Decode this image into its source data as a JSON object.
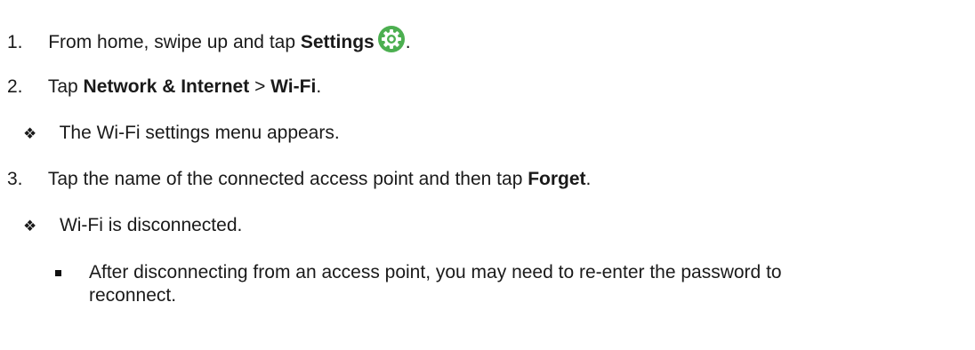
{
  "steps": [
    {
      "number": "1.",
      "pre": "From home, swipe up and tap ",
      "bold": "Settings",
      "post": "."
    },
    {
      "number": "2.",
      "pre": "Tap ",
      "bold1": "Network & Internet",
      "mid": " > ",
      "bold2": "Wi-Fi",
      "post": "."
    },
    {
      "number": "3.",
      "pre": "Tap the name of the connected access point and then tap ",
      "bold": "Forget",
      "post": "."
    }
  ],
  "results": [
    {
      "bullet": "❖",
      "text": "The Wi-Fi settings menu appears."
    },
    {
      "bullet": "❖",
      "text": "Wi-Fi is disconnected."
    }
  ],
  "note": {
    "line1": "After disconnecting from an access point, you may need to re-enter the password to",
    "line2": "reconnect."
  },
  "icons": {
    "settings": "settings-gear-icon",
    "settings_color": "#4caf50"
  }
}
